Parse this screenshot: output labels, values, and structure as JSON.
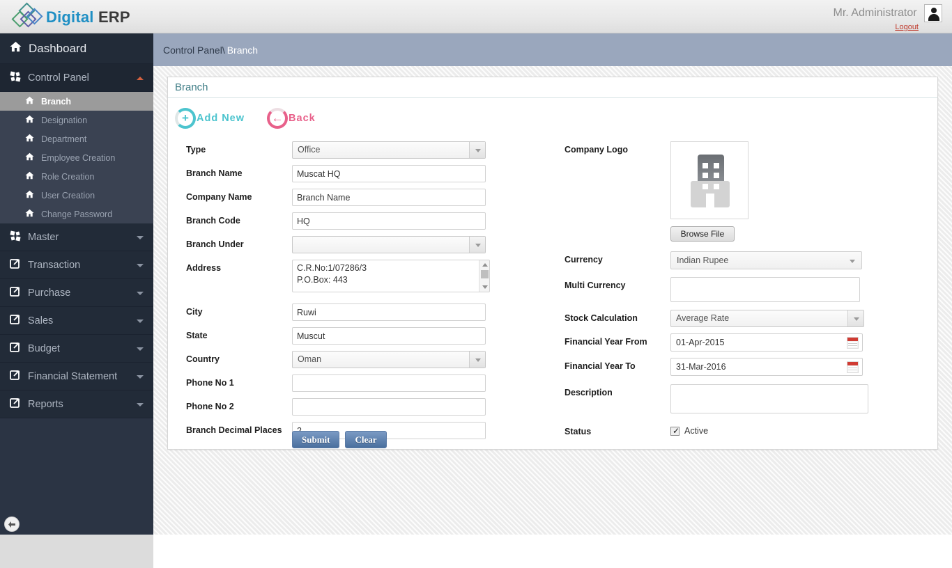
{
  "app": {
    "logo_primary": "Digital",
    "logo_secondary": "ERP",
    "logo_color_primary": "#1f8fc4",
    "logo_color_secondary": "#3a3a3a"
  },
  "header": {
    "user_name": "Mr. Administrator",
    "logout_label": "Logout",
    "avatar_icon": "user-avatar-icon"
  },
  "sidebar": {
    "dashboard_label": "Dashboard",
    "groups": [
      {
        "label": "Control Panel",
        "icon": "pinwheel-icon",
        "expanded": true,
        "items": [
          {
            "label": "Branch",
            "active": true
          },
          {
            "label": "Designation",
            "active": false
          },
          {
            "label": "Department",
            "active": false
          },
          {
            "label": "Employee Creation",
            "active": false
          },
          {
            "label": "Role Creation",
            "active": false
          },
          {
            "label": "User Creation",
            "active": false
          },
          {
            "label": "Change Password",
            "active": false
          }
        ]
      },
      {
        "label": "Master",
        "icon": "pinwheel-icon",
        "expanded": false,
        "items": []
      },
      {
        "label": "Transaction",
        "icon": "external-link-icon",
        "expanded": false,
        "items": []
      },
      {
        "label": "Purchase",
        "icon": "external-link-icon",
        "expanded": false,
        "items": []
      },
      {
        "label": "Sales",
        "icon": "external-link-icon",
        "expanded": false,
        "items": []
      },
      {
        "label": "Budget",
        "icon": "external-link-icon",
        "expanded": false,
        "items": []
      },
      {
        "label": "Financial Statement",
        "icon": "external-link-icon",
        "expanded": false,
        "items": []
      },
      {
        "label": "Reports",
        "icon": "external-link-icon",
        "expanded": false,
        "items": []
      }
    ],
    "collapse_icon": "arrow-left-icon"
  },
  "breadcrumb": {
    "parent": "Control Panel\\",
    "current": "Branch"
  },
  "panel": {
    "title": "Branch",
    "actions": [
      {
        "key": "add_new",
        "label": "Add New",
        "glyph": "+",
        "color": "#4cc4ce"
      },
      {
        "key": "back",
        "label": "Back",
        "glyph": "←",
        "color": "#e8608a"
      }
    ]
  },
  "form": {
    "left": {
      "type": {
        "label": "Type",
        "value": "Office"
      },
      "branch_name": {
        "label": "Branch Name",
        "value": "Muscat HQ"
      },
      "company_name": {
        "label": "Company Name",
        "value": "Branch Name"
      },
      "branch_code": {
        "label": "Branch Code",
        "value": "HQ"
      },
      "branch_under": {
        "label": "Branch Under",
        "value": ""
      },
      "address": {
        "label": "Address",
        "value": "C.R.No:1/07286/3\nP.O.Box: 443"
      },
      "city": {
        "label": "City",
        "value": "Ruwi"
      },
      "state": {
        "label": "State",
        "value": "Muscut"
      },
      "country": {
        "label": "Country",
        "value": "Oman"
      },
      "phone1": {
        "label": "Phone No 1",
        "value": ""
      },
      "phone2": {
        "label": "Phone No 2",
        "value": ""
      },
      "decimal_places": {
        "label": "Branch Decimal Places",
        "value": "2"
      }
    },
    "right": {
      "company_logo": {
        "label": "Company Logo",
        "image_icon": "building-placeholder-icon",
        "browse_label": "Browse File"
      },
      "currency": {
        "label": "Currency",
        "value": "Indian Rupee"
      },
      "multi_currency": {
        "label": "Multi Currency",
        "value": ""
      },
      "stock_calculation": {
        "label": "Stock Calculation",
        "value": "Average Rate"
      },
      "fy_from": {
        "label": "Financial Year From",
        "value": "01-Apr-2015",
        "icon": "calendar-icon"
      },
      "fy_to": {
        "label": "Financial Year To",
        "value": "31-Mar-2016",
        "icon": "calendar-icon"
      },
      "description": {
        "label": "Description",
        "value": ""
      },
      "status": {
        "label": "Status",
        "checkbox_label": "Active",
        "checked": true
      }
    }
  },
  "buttons": {
    "submit": "Submit",
    "clear": "Clear"
  }
}
